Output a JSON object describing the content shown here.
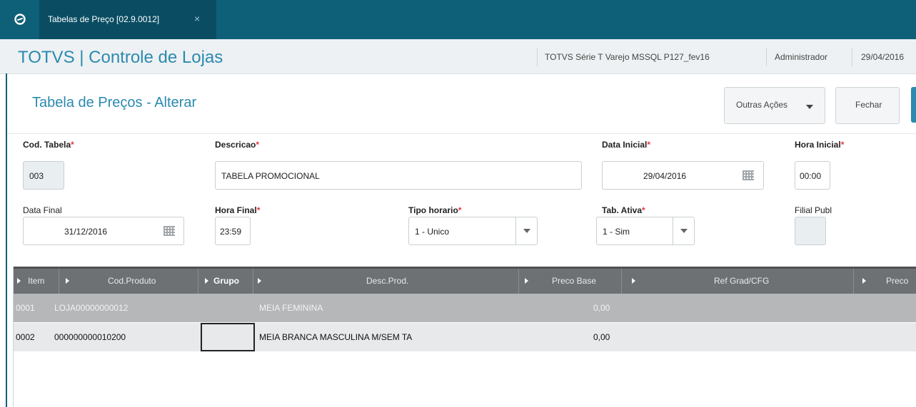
{
  "tabbar": {
    "tab_label": "Tabelas de Preço [02.9.0012]",
    "close_glyph": "×"
  },
  "header": {
    "app_title": "TOTVS | Controle de Lojas",
    "environment": "TOTVS Série T Varejo MSSQL P127_fev16",
    "user": "Administrador",
    "date": "29/04/2016"
  },
  "page": {
    "title": "Tabela de Preços - Alterar",
    "btn_outras": "Outras Ações",
    "btn_fechar": "Fechar"
  },
  "form": {
    "cod_tabela": {
      "label": "Cod. Tabela",
      "value": "003"
    },
    "descricao": {
      "label": "Descricao",
      "value": "TABELA PROMOCIONAL"
    },
    "data_inicial": {
      "label": "Data Inicial",
      "value": "29/04/2016"
    },
    "hora_inicial": {
      "label": "Hora Inicial",
      "value": "00:00"
    },
    "data_final": {
      "label": "Data Final",
      "value": "31/12/2016"
    },
    "hora_final": {
      "label": "Hora Final",
      "value": "23:59"
    },
    "tipo_horario": {
      "label": "Tipo horario",
      "value": "1 - Unico"
    },
    "tab_ativa": {
      "label": "Tab. Ativa",
      "value": "1 - Sim"
    },
    "filial_publ": {
      "label": "Filial Publ",
      "value": ""
    },
    "required_mark": "*"
  },
  "grid": {
    "columns": [
      "Item",
      "Cod.Produto",
      "Grupo",
      "Desc.Prod.",
      "Preco Base",
      "Ref Grad/CFG",
      "Preco"
    ],
    "rows": [
      {
        "item": "0001",
        "cod_produto": "LOJA00000000012",
        "grupo": "",
        "desc": "MEIA FEMININA",
        "preco_base": "0,00"
      },
      {
        "item": "0002",
        "cod_produto": "000000000010200",
        "grupo": "",
        "desc": "MEIA BRANCA MASCULINA M/SEM TA",
        "preco_base": "0,00"
      }
    ]
  },
  "colors": {
    "brand": "#0e5f78",
    "accent": "#2b8ab0",
    "required": "#e0393e"
  }
}
